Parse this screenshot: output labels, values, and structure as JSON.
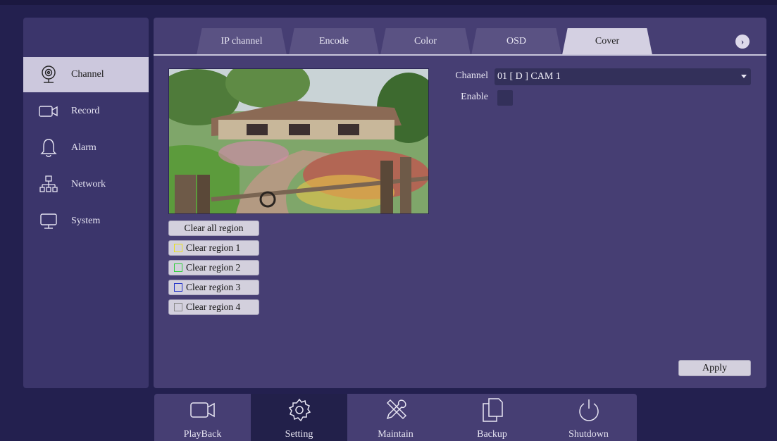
{
  "sidebar": {
    "items": [
      {
        "label": "Channel",
        "icon": "webcam-icon",
        "active": true
      },
      {
        "label": "Record",
        "icon": "video-camera-icon",
        "active": false
      },
      {
        "label": "Alarm",
        "icon": "bell-icon",
        "active": false
      },
      {
        "label": "Network",
        "icon": "network-icon",
        "active": false
      },
      {
        "label": "System",
        "icon": "monitor-icon",
        "active": false
      }
    ]
  },
  "tabs": [
    {
      "label": "IP channel",
      "active": false
    },
    {
      "label": "Encode",
      "active": false
    },
    {
      "label": "Color",
      "active": false
    },
    {
      "label": "OSD",
      "active": false
    },
    {
      "label": "Cover",
      "active": true
    }
  ],
  "next_icon": "chevron-right-icon",
  "form": {
    "channel_label": "Channel",
    "channel_value": "01 [ D ] CAM 1",
    "enable_label": "Enable",
    "enable_checked": false
  },
  "regions": {
    "clear_all": "Clear all region",
    "items": [
      {
        "label": "Clear region 1",
        "color": "#e8e020"
      },
      {
        "label": "Clear region 2",
        "color": "#2fcf3a"
      },
      {
        "label": "Clear region 3",
        "color": "#2030c8"
      },
      {
        "label": "Clear region 4",
        "color": "#8a8a8a"
      }
    ]
  },
  "apply_label": "Apply",
  "bottombar": [
    {
      "label": "PlayBack",
      "icon": "video-camera-icon",
      "active": false
    },
    {
      "label": "Setting",
      "icon": "gear-icon",
      "active": true
    },
    {
      "label": "Maintain",
      "icon": "tools-icon",
      "active": false
    },
    {
      "label": "Backup",
      "icon": "copy-icon",
      "active": false
    },
    {
      "label": "Shutdown",
      "icon": "power-icon",
      "active": false
    }
  ],
  "colors": {
    "background": "#23204f",
    "panel": "#463e73",
    "sidebar": "#3b356b",
    "active_tab": "#d4d0e2"
  }
}
